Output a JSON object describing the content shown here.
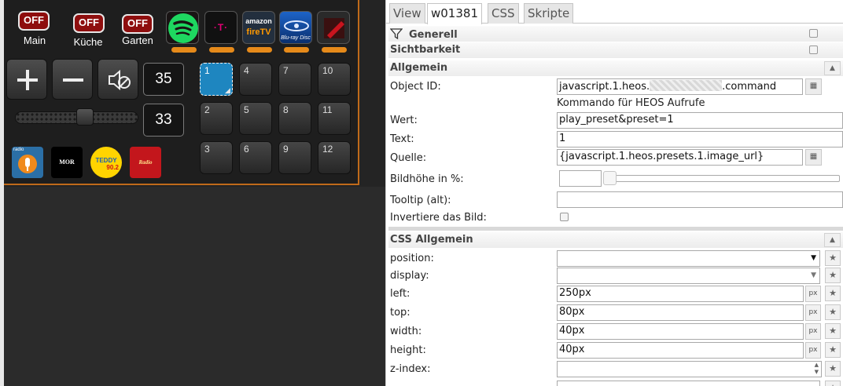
{
  "canvas": {
    "rooms": [
      {
        "state": "OFF",
        "label": "Main"
      },
      {
        "state": "OFF",
        "label": "Küche"
      },
      {
        "state": "OFF",
        "label": "Garten"
      }
    ],
    "apps": [
      {
        "name": "spotify-icon",
        "text": ""
      },
      {
        "name": "telekom-icon",
        "text": "·T·"
      },
      {
        "name": "amazon-firetv-icon",
        "text_top": "amazon",
        "text_bottom": "fireTV"
      },
      {
        "name": "bluray-icon",
        "text": "Blu-ray Disc"
      },
      {
        "name": "red-app-icon",
        "text": ""
      }
    ],
    "volume_display": "35",
    "volume_value": "33",
    "volume_fraction": 0.58,
    "radios": [
      {
        "name": "radio-mic-icon",
        "text": "radio"
      },
      {
        "name": "mor-radio-icon",
        "text": "MOR"
      },
      {
        "name": "teddy-radio-icon",
        "text": "TEDDY",
        "sub": "90.2"
      },
      {
        "name": "red-radio-icon",
        "text": "Radio"
      }
    ],
    "presets": [
      [
        "1",
        "4",
        "7",
        "10"
      ],
      [
        "2",
        "5",
        "8",
        "11"
      ],
      [
        "3",
        "6",
        "9",
        "12"
      ]
    ]
  },
  "inspector": {
    "tabs": [
      "View",
      "w01381",
      "CSS",
      "Skripte"
    ],
    "groups": {
      "generell": "Generell",
      "sichtbarkeit": "Sichtbarkeit",
      "allgemein": "Allgemein",
      "css_allgemein": "CSS Allgemein"
    },
    "fields": {
      "object_id_label": "Object ID:",
      "object_id_prefix": "javascript.1.heos.",
      "object_id_suffix": ".command",
      "object_id_hint": "Kommando für HEOS Aufrufe",
      "wert_label": "Wert:",
      "wert_value": "play_preset&preset=1",
      "text_label": "Text:",
      "text_value": "1",
      "quelle_label": "Quelle:",
      "quelle_value": "{javascript.1.heos.presets.1.image_url}",
      "bildhoehe_label": "Bildhöhe in %:",
      "tooltip_label": "Tooltip (alt):",
      "invert_label": "Invertiere das Bild:"
    },
    "css": {
      "position_label": "position:",
      "display_label": "display:",
      "left_label": "left:",
      "left_value": "250px",
      "top_label": "top:",
      "top_value": "80px",
      "width_label": "width:",
      "width_value": "40px",
      "height_label": "height:",
      "height_value": "40px",
      "zindex_label": "z-index:",
      "px_unit": "px"
    }
  }
}
